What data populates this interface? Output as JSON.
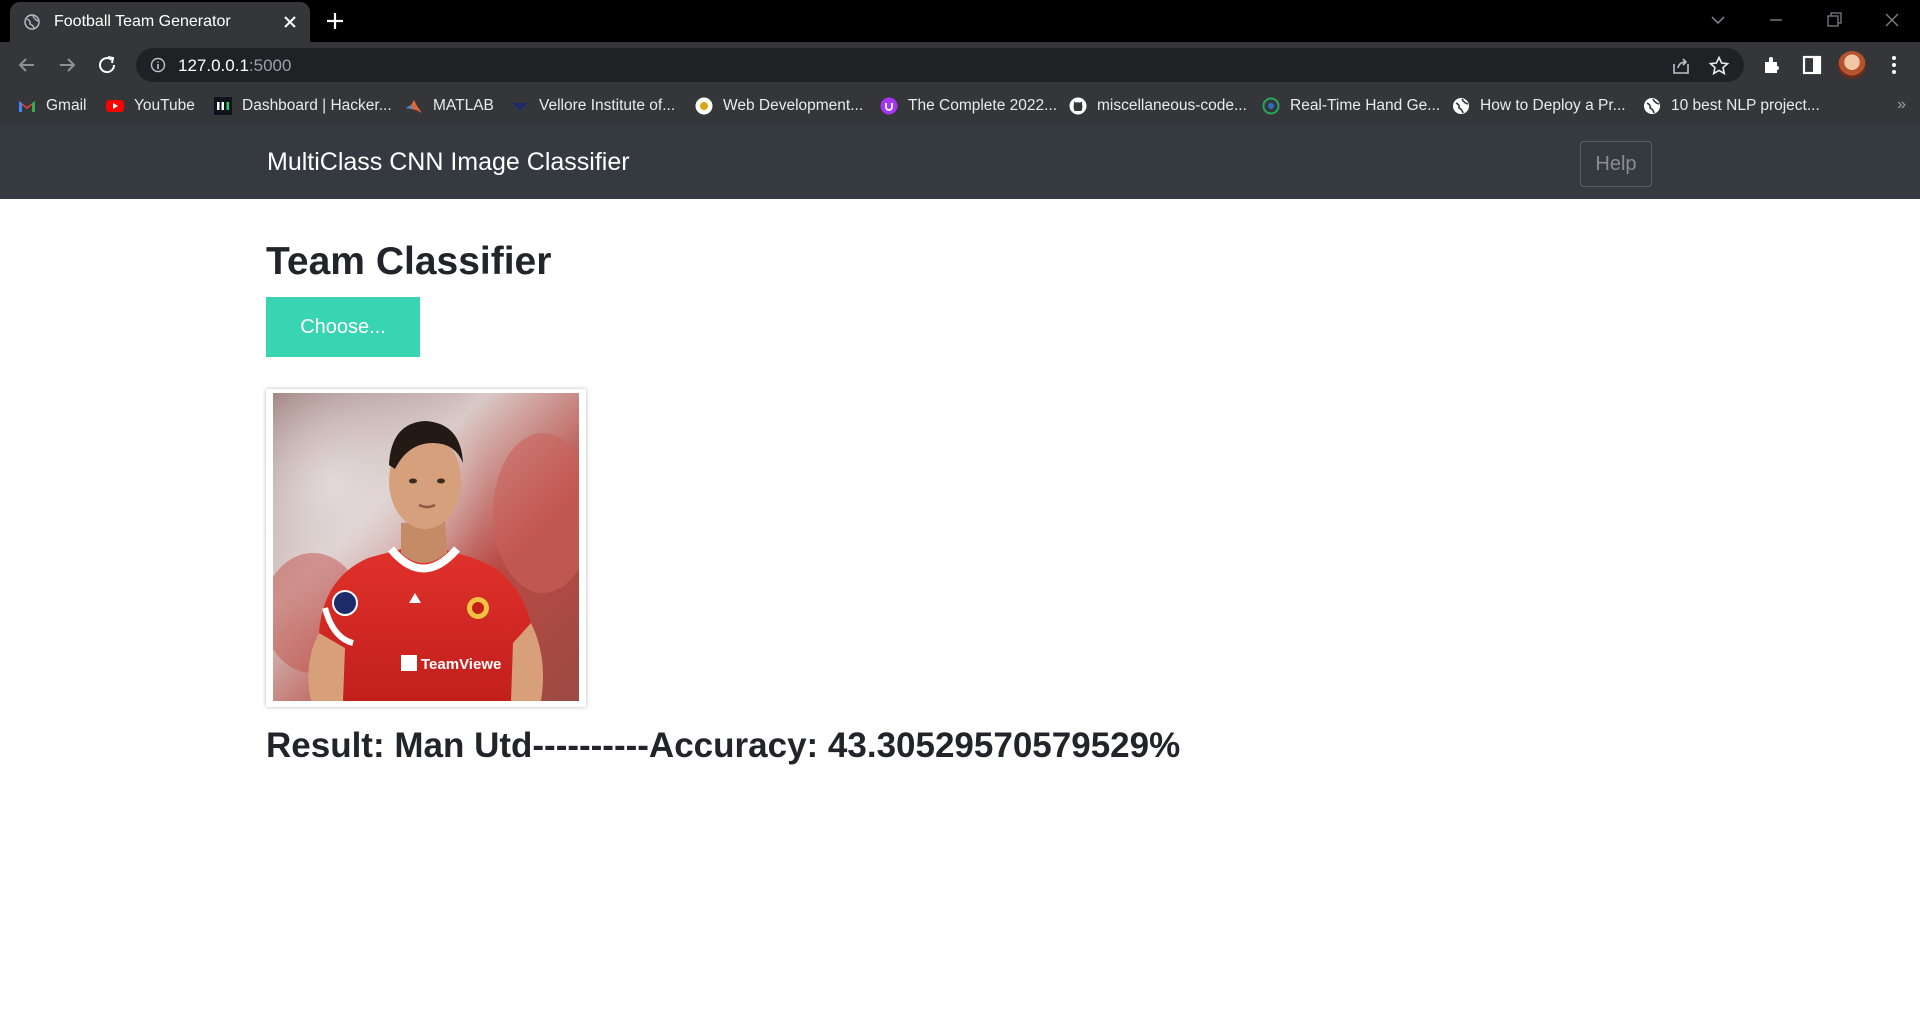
{
  "browser": {
    "tab_title": "Football Team Generator",
    "url_host": "127.0.0.1",
    "url_port": ":5000",
    "bookmarks": [
      {
        "label": "Gmail",
        "icon": "gmail-icon"
      },
      {
        "label": "YouTube",
        "icon": "youtube-icon"
      },
      {
        "label": "Dashboard | Hacker...",
        "icon": "hackerrank-icon"
      },
      {
        "label": "MATLAB",
        "icon": "matlab-icon"
      },
      {
        "label": "Vellore Institute of...",
        "icon": "vit-icon"
      },
      {
        "label": "Web Development...",
        "icon": "udemy-course-icon"
      },
      {
        "label": "The Complete 2022...",
        "icon": "udemy-icon"
      },
      {
        "label": "miscellaneous-code...",
        "icon": "github-icon"
      },
      {
        "label": "Real-Time Hand Ge...",
        "icon": "site-icon"
      },
      {
        "label": "How to Deploy a Pr...",
        "icon": "globe-icon"
      },
      {
        "label": "10 best NLP project...",
        "icon": "globe-icon"
      }
    ],
    "bookmarks_overflow": "»"
  },
  "navbar": {
    "brand": "MultiClass CNN Image Classifier",
    "help_label": "Help"
  },
  "main": {
    "title": "Team Classifier",
    "choose_label": "Choose...",
    "result_text": "Result: Man Utd----------Accuracy: 43.30529570579529%"
  },
  "colors": {
    "navbar_bg": "#343a40",
    "choose_bg": "#39d4b2",
    "chrome_bg": "#35363a",
    "omnibox_bg": "#202124"
  }
}
